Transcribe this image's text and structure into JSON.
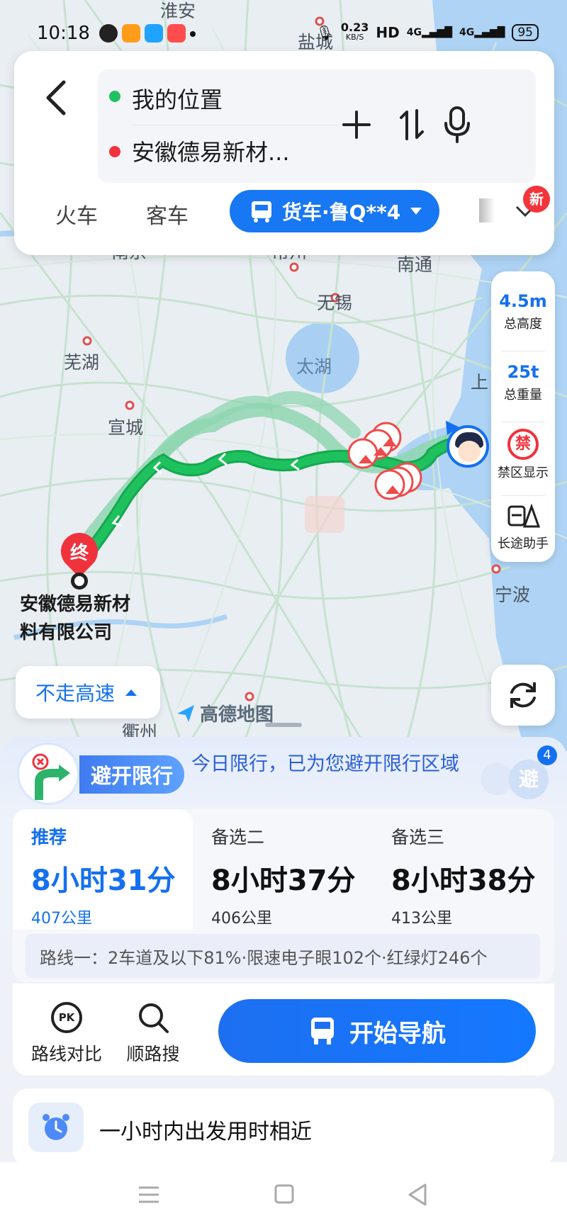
{
  "status_bar": {
    "time": "10:18",
    "speed": "0.23",
    "speed_unit": "KB/S",
    "hd": "HD",
    "net1": "4G",
    "net2": "4G",
    "battery": "95"
  },
  "search": {
    "origin": "我的位置",
    "destination": "安徽德易新材..."
  },
  "modes": {
    "train": "火车",
    "coach": "客车",
    "truck": "货车·鲁Q**4",
    "new_badge": "新"
  },
  "map": {
    "places": [
      "淮安",
      "盐城",
      "南京",
      "常州",
      "南通",
      "无锡",
      "芜湖",
      "太湖",
      "宣城",
      "上",
      "宁波",
      "衢州"
    ],
    "dest_pin": "终",
    "dest_label_line1": "安徽德易新材",
    "dest_label_line2": "料有限公司",
    "watermark": "高德地图"
  },
  "tools": {
    "height_value": "4.5m",
    "height_label": "总高度",
    "weight_value": "25t",
    "weight_label": "总重量",
    "restrict_icon": "禁",
    "restrict_label": "禁区显示",
    "longtrip_label": "长途助手"
  },
  "highway_toggle": "不走高速",
  "restriction": {
    "pill": "避开限行",
    "message": "今日限行，已为您避开限行区域",
    "avoid_label": "避",
    "avoid_count": "4"
  },
  "routes": [
    {
      "name": "推荐",
      "duration": "8小时31分",
      "distance": "407公里",
      "selected": true
    },
    {
      "name": "备选二",
      "duration": "8小时37分",
      "distance": "406公里",
      "selected": false
    },
    {
      "name": "备选三",
      "duration": "8小时38分",
      "distance": "413公里",
      "selected": false
    }
  ],
  "route_detail": "路线一：2车道及以下81%·限速电子眼102个·红绿灯246个",
  "actions": {
    "compare": "路线对比",
    "compare_icon": "PK",
    "search_along": "顺路搜",
    "start_nav": "开始导航"
  },
  "tip": "一小时内出发用时相近",
  "colors": {
    "accent": "#1570ef",
    "route_main": "#18b75a",
    "route_alt": "#8fd6b0",
    "danger": "#f3343b"
  }
}
